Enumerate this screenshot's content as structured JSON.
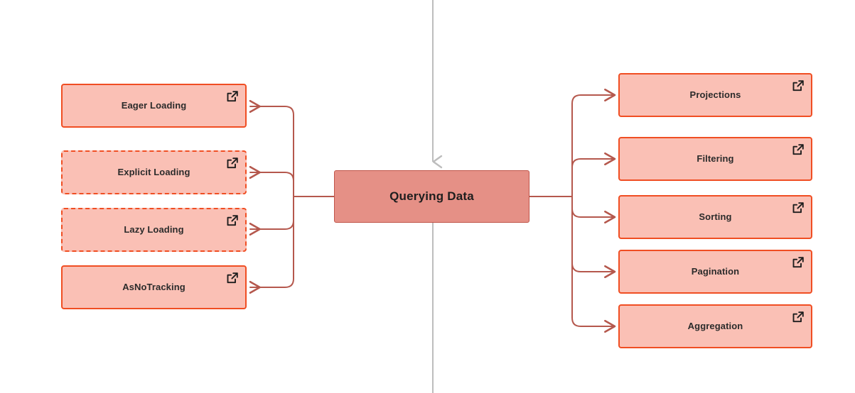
{
  "diagram": {
    "type": "mind-map",
    "title": "Querying Data",
    "center": {
      "label": "Querying Data",
      "fill": "#E59086",
      "border": "#C0554A"
    },
    "colors": {
      "node_fill": "#FAC0B5",
      "node_border": "#F04E23",
      "center_fill": "#E59086",
      "center_border": "#C0554A",
      "edge": "#B5584D",
      "spine": "#BDBDBD",
      "text": "#2B2B2B",
      "background": "#FFFFFF"
    },
    "left_branch": {
      "side": "left",
      "nodes": [
        {
          "label": "Eager Loading",
          "border_style": "solid",
          "icon": "external-link-icon"
        },
        {
          "label": "Explicit Loading",
          "border_style": "dashed",
          "icon": "external-link-icon"
        },
        {
          "label": "Lazy Loading",
          "border_style": "dashed",
          "icon": "external-link-icon"
        },
        {
          "label": "AsNoTracking",
          "border_style": "solid",
          "icon": "external-link-icon"
        }
      ]
    },
    "right_branch": {
      "side": "right",
      "nodes": [
        {
          "label": "Projections",
          "border_style": "solid",
          "icon": "external-link-icon"
        },
        {
          "label": "Filtering",
          "border_style": "solid",
          "icon": "external-link-icon"
        },
        {
          "label": "Sorting",
          "border_style": "solid",
          "icon": "external-link-icon"
        },
        {
          "label": "Pagination",
          "border_style": "solid",
          "icon": "external-link-icon"
        },
        {
          "label": "Aggregation",
          "border_style": "solid",
          "icon": "external-link-icon"
        }
      ]
    },
    "spine": {
      "description": "vertical connector line through center node",
      "arrow_direction": "down"
    }
  }
}
